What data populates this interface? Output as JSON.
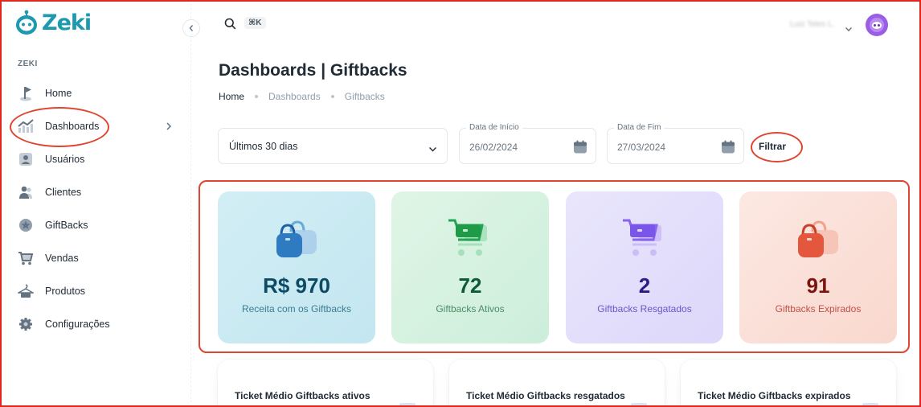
{
  "app": {
    "name": "Zeki",
    "brand_color": "#1e9ab0",
    "annotation_color": "#e0452f"
  },
  "sidebar": {
    "section_label": "ZEKI",
    "items": [
      {
        "label": "Home",
        "icon": "flag-icon"
      },
      {
        "label": "Dashboards",
        "icon": "chart-icon",
        "has_submenu": true
      },
      {
        "label": "Usuários",
        "icon": "user-badge-icon"
      },
      {
        "label": "Clientes",
        "icon": "users-icon"
      },
      {
        "label": "GiftBacks",
        "icon": "star-badge-icon"
      },
      {
        "label": "Vendas",
        "icon": "cart-icon"
      },
      {
        "label": "Produtos",
        "icon": "hanger-icon"
      },
      {
        "label": "Configurações",
        "icon": "gear-icon"
      }
    ]
  },
  "topbar": {
    "search_shortcut": "⌘K",
    "user_name": "Luiz Teles L."
  },
  "page": {
    "title": "Dashboards | Giftbacks",
    "breadcrumb": [
      "Home",
      "Dashboards",
      "Giftbacks"
    ]
  },
  "filters": {
    "period": "Últimos 30 dias",
    "start_label": "Data de Início",
    "start_value": "26/02/2024",
    "end_label": "Data de Fim",
    "end_value": "27/03/2024",
    "button": "Filtrar"
  },
  "cards": [
    {
      "value": "R$ 970",
      "label": "Receita com os Giftbacks",
      "icon": "shopping-bags-icon"
    },
    {
      "value": "72",
      "label": "Giftbacks Ativos",
      "icon": "shopping-cart-icon"
    },
    {
      "value": "2",
      "label": "Giftbacks Resgatados",
      "icon": "shopping-cart-icon"
    },
    {
      "value": "91",
      "label": "Giftbacks Expirados",
      "icon": "shopping-bags-icon"
    }
  ],
  "stats": [
    {
      "title": "Ticket Médio Giftbacks ativos"
    },
    {
      "title": "Ticket Médio Giftbacks resgatados"
    },
    {
      "title": "Ticket Médio Giftbacks expirados"
    }
  ]
}
